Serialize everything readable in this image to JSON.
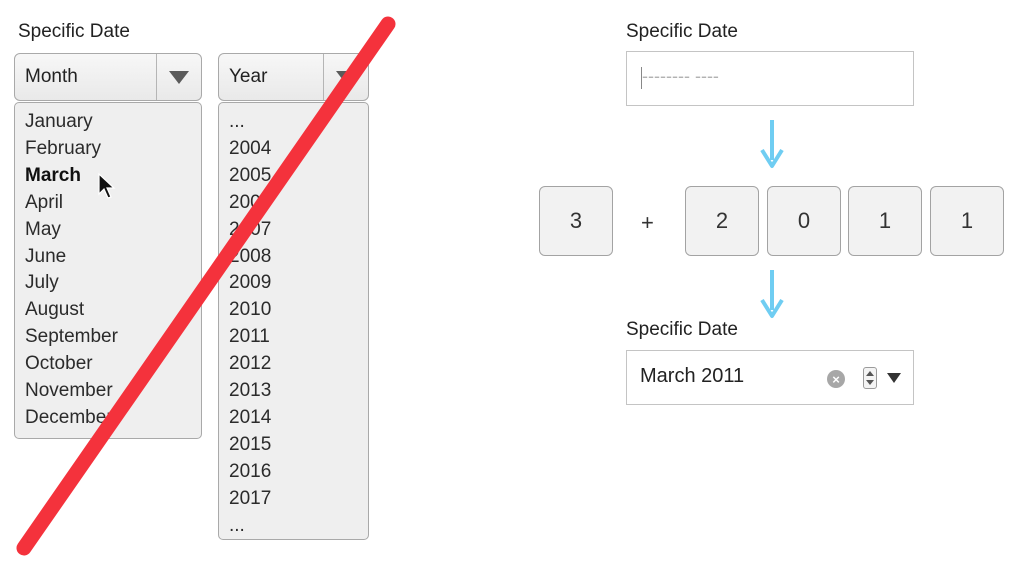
{
  "left": {
    "label": "Specific Date",
    "month_select": {
      "value": "Month"
    },
    "year_select": {
      "value": "Year"
    },
    "month_options": [
      "January",
      "February",
      "March",
      "April",
      "May",
      "June",
      "July",
      "August",
      "September",
      "October",
      "November",
      "December"
    ],
    "selected_month": "March",
    "year_options": [
      "...",
      "2004",
      "2005",
      "2006",
      "2007",
      "2008",
      "2009",
      "2010",
      "2011",
      "2012",
      "2013",
      "2014",
      "2015",
      "2016",
      "2017",
      "..."
    ],
    "strike_color": "#f4323c"
  },
  "right": {
    "label_top": "Specific Date",
    "placeholder": "-------- ----",
    "keys": [
      "3",
      "2",
      "0",
      "1",
      "1"
    ],
    "plus": "+",
    "label_bottom": "Specific Date",
    "result_value": "March 2011",
    "arrow_color": "#6fcdf2"
  }
}
